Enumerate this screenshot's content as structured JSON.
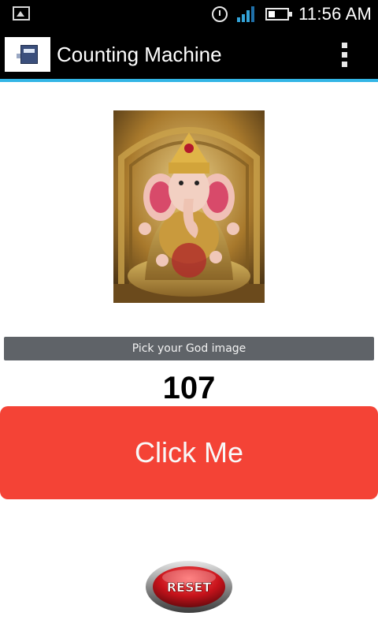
{
  "status_bar": {
    "time": "11:56 AM"
  },
  "action_bar": {
    "title": "Counting Machine"
  },
  "main": {
    "pick_button_label": "Pick your God image",
    "count": "107",
    "click_button_label": "Click Me",
    "reset_button_label": "RESET"
  },
  "colors": {
    "accent_line": "#33b5e5",
    "click_button": "#f44336",
    "pick_button": "#5f6368",
    "reset_button": "#c7131b"
  }
}
